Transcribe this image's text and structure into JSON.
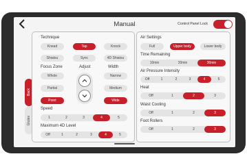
{
  "header": {
    "title": "Manual",
    "control_panel_lock_label": "Control Panel Lock",
    "lock_on": true
  },
  "side_tabs": [
    {
      "label": "Back",
      "active": true
    },
    {
      "label": "Glutes",
      "active": false
    }
  ],
  "left": {
    "technique": {
      "label": "Technique",
      "options": [
        "Knead",
        "Tap",
        "Knock",
        "Shiatsu",
        "Sync",
        "4D Shiatsu"
      ],
      "active": "Tap"
    },
    "focus_zone": {
      "label": "Focus Zone",
      "options": [
        "Whole",
        "Partial",
        "Point"
      ],
      "active": "Point"
    },
    "adjust": {
      "label": "Adjust"
    },
    "width": {
      "label": "Width",
      "options": [
        "Narrow",
        "Medium",
        "Wide"
      ],
      "active": "Wide"
    },
    "speed": {
      "label": "Speed",
      "options": [
        "1",
        "2",
        "3",
        "4",
        "5"
      ],
      "active": "4"
    },
    "max_4d": {
      "label": "Maximum 4D Level",
      "options": [
        "Off",
        "1",
        "2",
        "3",
        "4",
        "5"
      ],
      "active": "4"
    }
  },
  "right": {
    "air_settings": {
      "label": "Air Settings",
      "options": [
        "Full",
        "Upper body",
        "Lower body"
      ],
      "active": "Upper body"
    },
    "time_remaining": {
      "label": "Time Remaining",
      "options": [
        "10min",
        "20min",
        "30min"
      ],
      "active": "30min"
    },
    "air_pressure": {
      "label": "Air Pressure Intensity",
      "options": [
        "Off",
        "1",
        "2",
        "3",
        "4",
        "5"
      ],
      "active": "4"
    },
    "heat": {
      "label": "Heat",
      "options": [
        "Off",
        "1",
        "2",
        "3"
      ],
      "active": "2"
    },
    "waist_cooling": {
      "label": "Waist Cooling",
      "options": [
        "Off",
        "1",
        "2",
        "3"
      ],
      "active": "3"
    },
    "foot_rollers": {
      "label": "Foot Rollers",
      "options": [
        "Off",
        "1",
        "2",
        "3"
      ],
      "active": "3"
    }
  },
  "colors": {
    "accent": "#c8202b",
    "bezel": "#2c2c2c",
    "inactive": "#e4e4e4"
  }
}
